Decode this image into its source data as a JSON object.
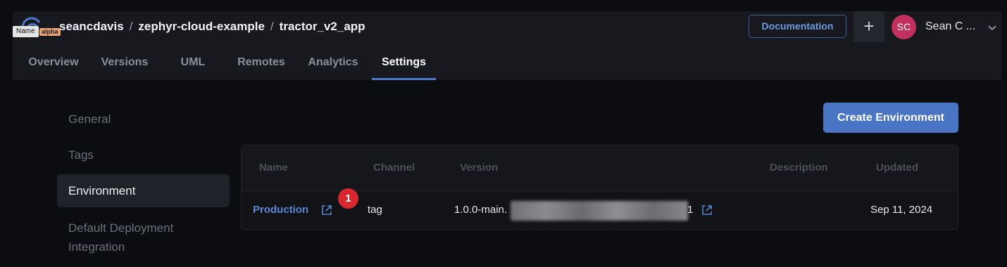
{
  "header": {
    "alpha_badge": "alpha",
    "tooltip": "Name",
    "breadcrumb": [
      "seancdavis",
      "zephyr-cloud-example",
      "tractor_v2_app"
    ],
    "documentation_label": "Documentation",
    "plus_label": "+",
    "user_initials": "SC",
    "user_name": "Sean C ...",
    "avatar_color": "#c2305e"
  },
  "tabs": [
    {
      "label": "Overview"
    },
    {
      "label": "Versions"
    },
    {
      "label": "UML"
    },
    {
      "label": "Remotes"
    },
    {
      "label": "Analytics"
    },
    {
      "label": "Settings",
      "active": true
    }
  ],
  "settings_nav": [
    {
      "label": "General"
    },
    {
      "label": "Tags"
    },
    {
      "label": "Environment",
      "active": true
    },
    {
      "label": "Default Deployment Integration"
    }
  ],
  "create_environment_label": "Create Environment",
  "table": {
    "columns": [
      "Name",
      "Channel",
      "Version",
      "Description",
      "Updated"
    ],
    "rows": [
      {
        "name": "Production",
        "channel": "tag",
        "version_prefix": "1.0.0-main.",
        "version_suffix": "1",
        "description": "",
        "updated": "Sep 11, 2024"
      }
    ]
  },
  "annotation_marker": "1",
  "colors": {
    "accent": "#4a74c4",
    "link": "#5b86d6",
    "marker": "#d7272f"
  }
}
